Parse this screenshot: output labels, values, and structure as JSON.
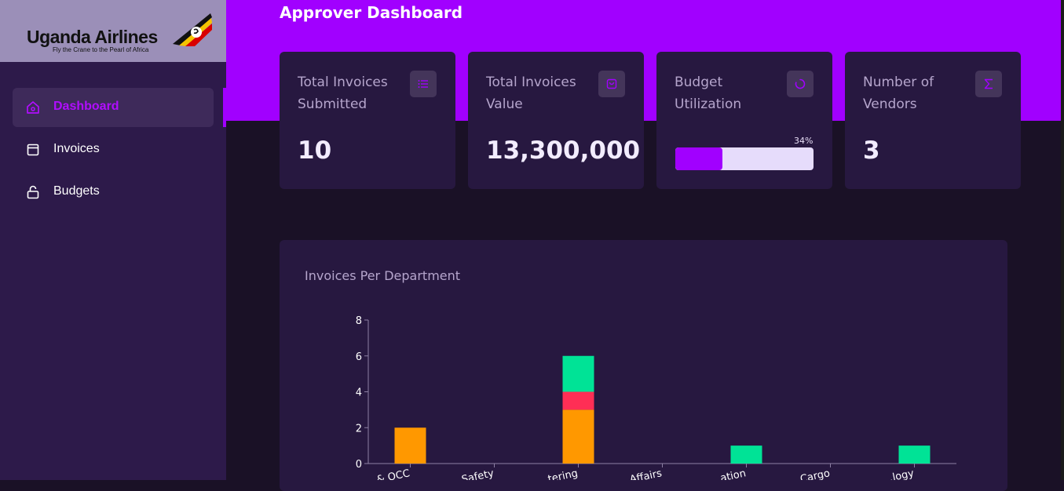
{
  "brand": {
    "name": "Uganda Airlines",
    "tagline": "Fly the Crane to the Pearl of Africa"
  },
  "sidebar": {
    "items": [
      {
        "label": "Dashboard",
        "icon": "home-icon",
        "active": true
      },
      {
        "label": "Invoices",
        "icon": "calendar-icon",
        "active": false
      },
      {
        "label": "Budgets",
        "icon": "unlock-icon",
        "active": false
      }
    ]
  },
  "header": {
    "title": "Approver Dashboard"
  },
  "cards": [
    {
      "title": "Total Invoices Submitted",
      "value": "10",
      "icon": "list-icon"
    },
    {
      "title": "Total Invoices Value",
      "value": "13,300,000",
      "icon": "bag-icon"
    },
    {
      "title": "Budget Utilization",
      "progress_label": "34%",
      "progress": 34,
      "icon": "loader-icon"
    },
    {
      "title": "Number of Vendors",
      "value": "3",
      "icon": "sigma-icon"
    }
  ],
  "colors": {
    "accent": "#a100ff",
    "series_orange": "#ff9800",
    "series_red": "#ff2e55",
    "series_green": "#00e396"
  },
  "chart_data": {
    "type": "bar",
    "stacked": true,
    "title": "Invoices Per Department",
    "categories": [
      "& OCC",
      "Safety",
      "...tering",
      "Affairs",
      "...ation",
      "Cargo",
      "...logy"
    ],
    "series": [
      {
        "values": [
          2,
          0,
          3,
          0,
          0,
          0,
          0
        ],
        "color": "#ff9800"
      },
      {
        "values": [
          0,
          0,
          1,
          0,
          0,
          0,
          0
        ],
        "color": "#ff2e55"
      },
      {
        "values": [
          0,
          0,
          2,
          0,
          1,
          0,
          1
        ],
        "color": "#00e396"
      }
    ],
    "yticks": [
      0,
      2,
      4,
      6,
      8
    ],
    "ylim": [
      0,
      8
    ],
    "xlabel": "",
    "ylabel": ""
  }
}
